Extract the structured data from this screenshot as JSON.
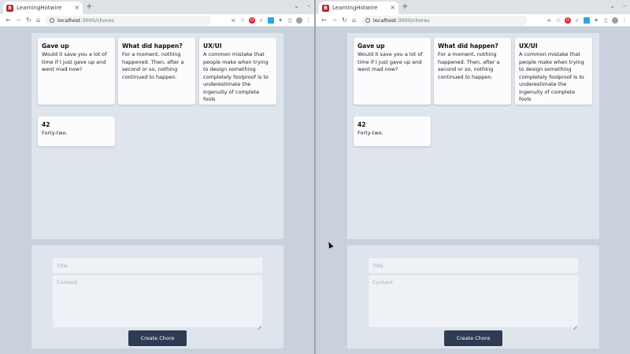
{
  "browser": {
    "tab_title": "LearningHotwire",
    "favicon_letter": "B",
    "tab_close": "×",
    "new_tab": "+",
    "chevron": "⌄",
    "minimize": "–",
    "url_host": "localhost",
    "url_path": ":3000/chores",
    "back": "←",
    "forward": "→",
    "reload": "↻",
    "home": "⌂",
    "share": "⋖",
    "star": "☆",
    "extensions": "✦",
    "sidepanel": "▯",
    "menu": "⋮"
  },
  "chores": [
    {
      "title": "Gave up",
      "content": "Would it save you a lot of time if I just gave up and went mad now?"
    },
    {
      "title": "What did happen?",
      "content": "For a moment, nothing happened. Then, after a second or so, nothing continued to happen."
    },
    {
      "title": "UX/UI",
      "content": "A common mistake that people make when trying to design something completely foolproof is to underestimate the ingenuity of complete fools"
    },
    {
      "title": "42",
      "content": "Forty-two."
    }
  ],
  "form": {
    "title_placeholder": "Title",
    "content_placeholder": "Content",
    "submit_label": "Create Chore"
  },
  "colors": {
    "page_bg": "#c9d1dd",
    "panel_bg": "#dfe5ec",
    "card_bg": "#fcfbfe",
    "button_bg": "#2f3b52",
    "favicon": "#b4282c"
  }
}
